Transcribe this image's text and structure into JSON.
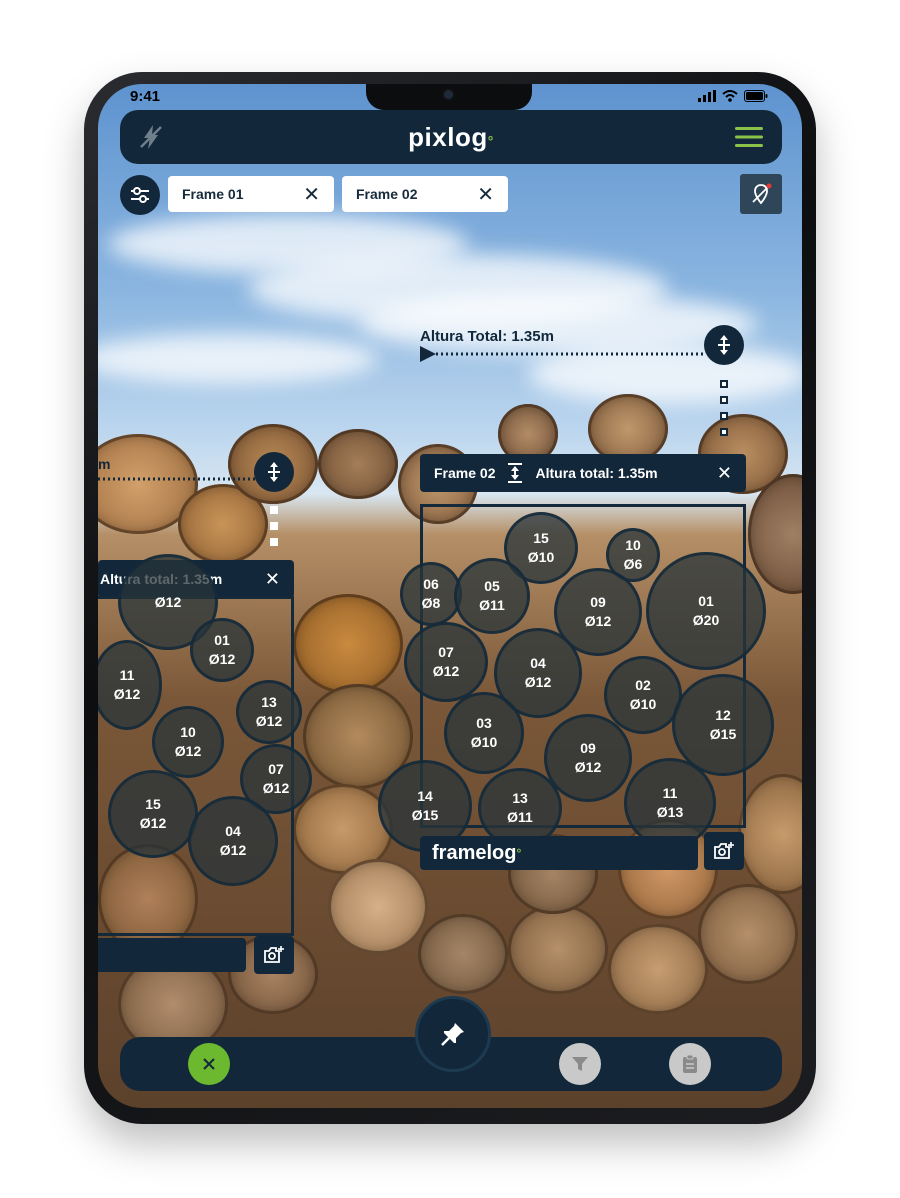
{
  "status": {
    "time": "9:41"
  },
  "header": {
    "logo": "pixlog"
  },
  "tabs": [
    {
      "label": "Frame 01"
    },
    {
      "label": "Frame 02"
    }
  ],
  "measure": {
    "label": "Altura Total: 1.35m"
  },
  "frame2": {
    "title": "Frame  02",
    "height": "Altura total:  1.35m",
    "footer_logo": "framelog",
    "logs": [
      {
        "id": "15",
        "d": "Ø10"
      },
      {
        "id": "10",
        "d": "Ø6"
      },
      {
        "id": "06",
        "d": "Ø8"
      },
      {
        "id": "05",
        "d": "Ø11"
      },
      {
        "id": "09",
        "d": "Ø12"
      },
      {
        "id": "01",
        "d": "Ø20"
      },
      {
        "id": "07",
        "d": "Ø12"
      },
      {
        "id": "04",
        "d": "Ø12"
      },
      {
        "id": "02",
        "d": "Ø10"
      },
      {
        "id": "12",
        "d": "Ø15"
      },
      {
        "id": "03",
        "d": "Ø10"
      },
      {
        "id": "09",
        "d": "Ø12"
      },
      {
        "id": "14",
        "d": "Ø15"
      },
      {
        "id": "13",
        "d": "Ø11"
      },
      {
        "id": "11",
        "d": "Ø13"
      }
    ]
  },
  "frame1": {
    "height": "Altura total:  1.35m",
    "side_text": "m",
    "logs": [
      {
        "id": "",
        "d": "Ø12"
      },
      {
        "id": "01",
        "d": "Ø12"
      },
      {
        "id": "11",
        "d": "Ø12"
      },
      {
        "id": "13",
        "d": "Ø12"
      },
      {
        "id": "10",
        "d": "Ø12"
      },
      {
        "id": "07",
        "d": "Ø12"
      },
      {
        "id": "15",
        "d": "Ø12"
      },
      {
        "id": "04",
        "d": "Ø12"
      }
    ]
  },
  "colors": {
    "primary": "#12283a",
    "accent": "#8bc34a",
    "confirm": "#6cb82f",
    "disabled": "#c9c9c9"
  }
}
